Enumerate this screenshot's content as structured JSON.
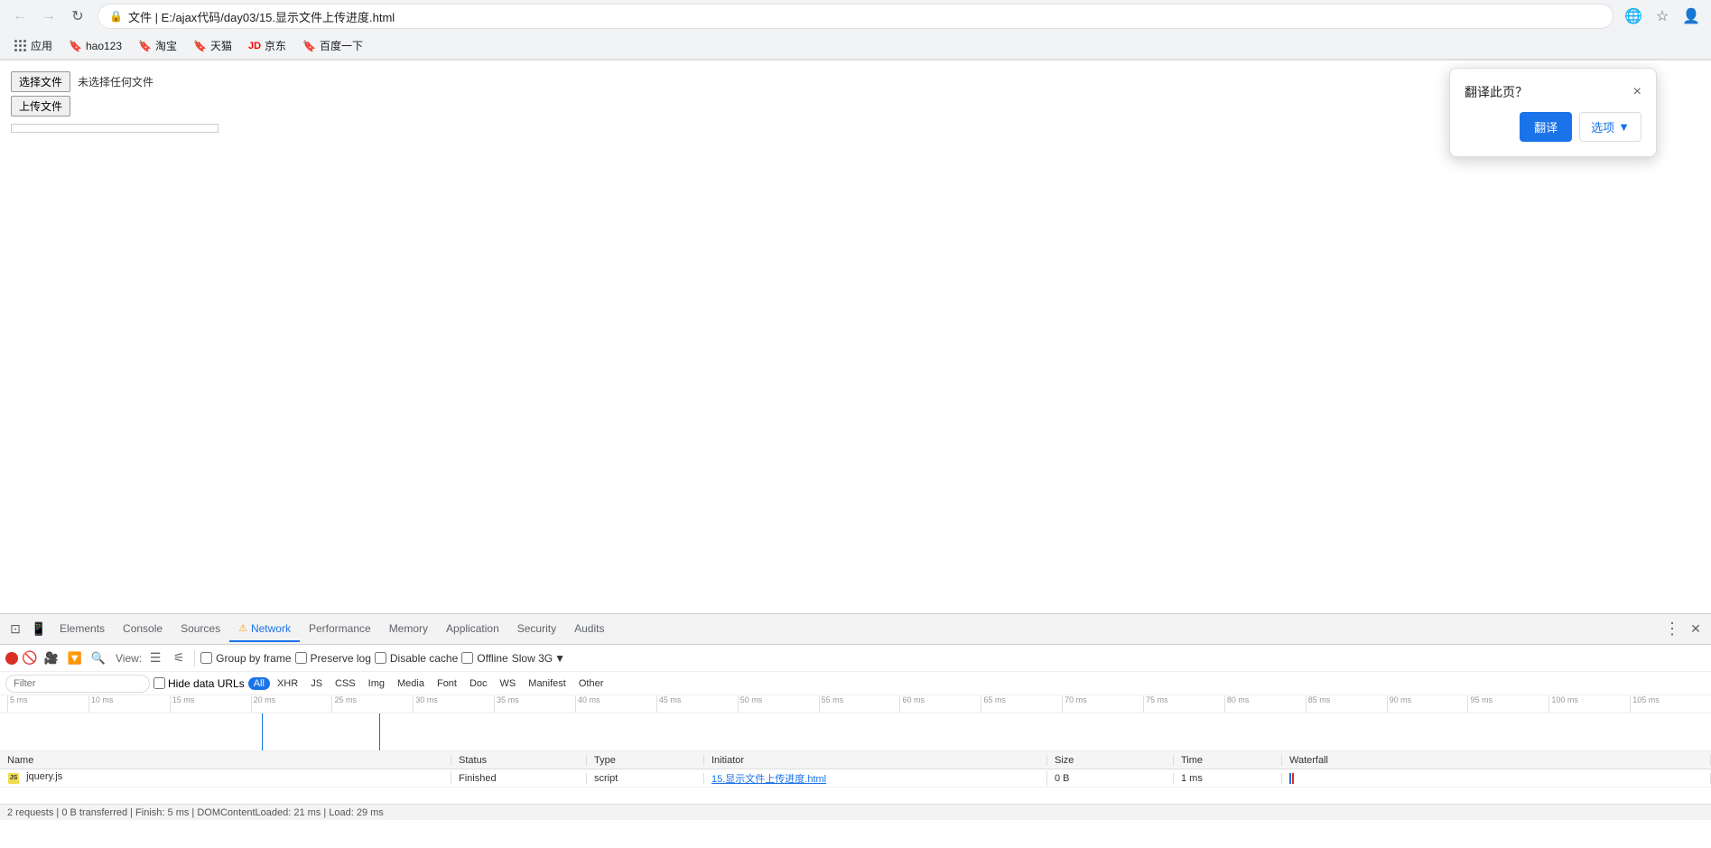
{
  "browser": {
    "title": "E:/ajax代码/day03/15.显示文件上传进度.html",
    "address": "文件 | E:/ajax代码/day03/15.显示文件上传进度.html",
    "security_icon": "🔒",
    "bookmarks": [
      {
        "label": "应用",
        "icon": "⊞"
      },
      {
        "label": "hao123"
      },
      {
        "label": "淘宝"
      },
      {
        "label": "天猫"
      },
      {
        "label": "京东"
      },
      {
        "label": "百度一下"
      }
    ]
  },
  "page": {
    "choose_file_btn": "选择文件",
    "file_name": "未选择任何文件",
    "upload_btn": "上传文件"
  },
  "translate_popup": {
    "title": "翻译此页？",
    "translate_btn": "翻译",
    "options_btn": "选项",
    "close_btn": "×"
  },
  "devtools": {
    "tabs": [
      {
        "label": "Elements",
        "active": false
      },
      {
        "label": "Console",
        "active": false
      },
      {
        "label": "Sources",
        "active": false
      },
      {
        "label": "Network",
        "active": true,
        "warn": true
      },
      {
        "label": "Performance",
        "active": false
      },
      {
        "label": "Memory",
        "active": false
      },
      {
        "label": "Application",
        "active": false
      },
      {
        "label": "Security",
        "active": false
      },
      {
        "label": "Audits",
        "active": false
      }
    ],
    "network": {
      "view_label": "View:",
      "group_by_frame": "Group by frame",
      "preserve_log": "Preserve log",
      "disable_cache": "Disable cache",
      "offline": "Offline",
      "slow3g": "Slow 3G",
      "filter_placeholder": "Filter",
      "hide_data_urls": "Hide data URLs",
      "filter_types": [
        "All",
        "XHR",
        "JS",
        "CSS",
        "Img",
        "Media",
        "Font",
        "Doc",
        "WS",
        "Manifest",
        "Other"
      ],
      "active_filter": "All",
      "timeline_ticks": [
        "5 ms",
        "10 ms",
        "15 ms",
        "20 ms",
        "25 ms",
        "30 ms",
        "35 ms",
        "40 ms",
        "45 ms",
        "50 ms",
        "55 ms",
        "60 ms",
        "65 ms",
        "70 ms",
        "75 ms",
        "80 ms",
        "85 ms",
        "90 ms",
        "95 ms",
        "100 ms",
        "105 ms"
      ],
      "table_headers": [
        "Name",
        "Status",
        "Type",
        "Initiator",
        "Size",
        "Time",
        "Waterfall"
      ],
      "rows": [
        {
          "name": "jquery.js",
          "type_icon": "js",
          "status": "Finished",
          "type": "script",
          "initiator": "15.显示文件上传进度.html",
          "size": "0 B",
          "time": "1 ms"
        }
      ],
      "status_bar": "2 requests | 0 B transferred | Finish: 5 ms | DOMContentLoaded: 21 ms | Load: 29 ms"
    }
  }
}
